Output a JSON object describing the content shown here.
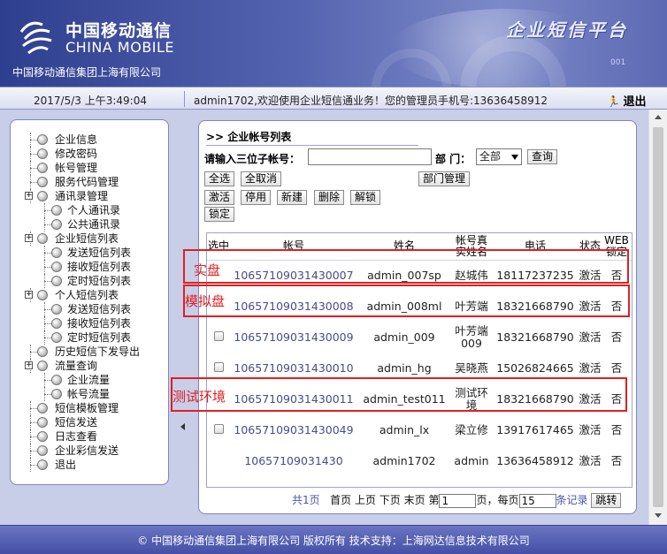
{
  "header": {
    "brand_cn": "中国移动通信",
    "brand_en": "CHINA MOBILE",
    "company": "中国移动通信集团上海有限公司",
    "platform_title": "企业短信平台",
    "deco_number": "001"
  },
  "infobar": {
    "datetime": "2017/5/3 上午3:49:04",
    "welcome": "admin1702,欢迎使用企业短信通业务！您的管理员手机号:13636458912",
    "logout": "退出"
  },
  "sidebar": {
    "items": [
      {
        "label": "企业信息",
        "level": 0,
        "expandable": false
      },
      {
        "label": "修改密码",
        "level": 0,
        "expandable": false
      },
      {
        "label": "帐号管理",
        "level": 0,
        "expandable": false
      },
      {
        "label": "服务代码管理",
        "level": 0,
        "expandable": false
      },
      {
        "label": "通讯录管理",
        "level": 0,
        "expandable": true
      },
      {
        "label": "个人通讯录",
        "level": 1,
        "expandable": false
      },
      {
        "label": "公共通讯录",
        "level": 1,
        "expandable": false
      },
      {
        "label": "企业短信列表",
        "level": 0,
        "expandable": true
      },
      {
        "label": "发送短信列表",
        "level": 1,
        "expandable": false
      },
      {
        "label": "接收短信列表",
        "level": 1,
        "expandable": false
      },
      {
        "label": "定时短信列表",
        "level": 1,
        "expandable": false
      },
      {
        "label": "个人短信列表",
        "level": 0,
        "expandable": true
      },
      {
        "label": "发送短信列表",
        "level": 1,
        "expandable": false
      },
      {
        "label": "接收短信列表",
        "level": 1,
        "expandable": false
      },
      {
        "label": "定时短信列表",
        "level": 1,
        "expandable": false
      },
      {
        "label": "历史短信下发导出",
        "level": 0,
        "expandable": false
      },
      {
        "label": "流量查询",
        "level": 0,
        "expandable": true
      },
      {
        "label": "企业流量",
        "level": 1,
        "expandable": false
      },
      {
        "label": "帐号流量",
        "level": 1,
        "expandable": false
      },
      {
        "label": "短信模板管理",
        "level": 0,
        "expandable": false
      },
      {
        "label": "短信发送",
        "level": 0,
        "expandable": false
      },
      {
        "label": "日志查看",
        "level": 0,
        "expandable": false
      },
      {
        "label": "企业彩信发送",
        "level": 0,
        "expandable": false
      },
      {
        "label": "退出",
        "level": 0,
        "expandable": false
      }
    ]
  },
  "main": {
    "title": ">> 企业帐号列表",
    "search_label": "请输入三位子帐号：",
    "search_value": "",
    "dept_label": "部 门：",
    "dept_selected": "全部",
    "query_button": "查询",
    "buttons": {
      "select_all": "全选",
      "deselect_all": "全取消",
      "dept_manage": "部门管理",
      "activate": "激活",
      "disable": "停用",
      "create": "新建",
      "delete": "删除",
      "unlock": "解锁",
      "lock": "锁定"
    },
    "table": {
      "headers": [
        "选中",
        "帐号",
        "姓名",
        "帐号真实姓名",
        "电话",
        "状态",
        "WEB锁定"
      ],
      "rows": [
        {
          "account": "10657109031430007",
          "name": "admin_007sp",
          "real_name": "赵城伟",
          "phone": "18117237235",
          "status": "激活",
          "web_lock": "否",
          "checkbox": false
        },
        {
          "account": "10657109031430008",
          "name": "admin_008ml",
          "real_name": "叶芳端",
          "phone": "18321668790",
          "status": "激活",
          "web_lock": "否",
          "checkbox": false
        },
        {
          "account": "10657109031430009",
          "name": "admin_009",
          "real_name": "叶芳端009",
          "phone": "18321668790",
          "status": "激活",
          "web_lock": "否",
          "checkbox": true
        },
        {
          "account": "10657109031430010",
          "name": "admin_hg",
          "real_name": "吴晓燕",
          "phone": "15026824665",
          "status": "激活",
          "web_lock": "否",
          "checkbox": true
        },
        {
          "account": "10657109031430011",
          "name": "admin_test011",
          "real_name": "测试环境",
          "phone": "18321668790",
          "status": "激活",
          "web_lock": "否",
          "checkbox": false
        },
        {
          "account": "10657109031430049",
          "name": "admin_lx",
          "real_name": "梁立修",
          "phone": "13917617465",
          "status": "激活",
          "web_lock": "否",
          "checkbox": true
        },
        {
          "account": "10657109031430",
          "name": "admin1702",
          "real_name": "admin",
          "phone": "13636458912",
          "status": "激活",
          "web_lock": "否",
          "checkbox": false
        }
      ]
    },
    "pager": {
      "total": "共1页",
      "first": "首页",
      "prev": "上页",
      "next": "下页",
      "last": "末页",
      "page_prefix": "第",
      "page_value": "1",
      "page_suffix": "页，每页",
      "per_page_value": "15",
      "per_page_suffix": "条记录",
      "go_button": "跳转"
    }
  },
  "annotations": {
    "live": "实盘",
    "simulated": "模拟盘",
    "test_env": "测试环境",
    "color": "#e02020"
  },
  "footer": {
    "text": "© 中国移动通信集团上海有限公司 版权所有    技术支持：上海网达信息技术有限公司"
  },
  "colors": {
    "header_dark": "#2e3f8f",
    "page_bg": "#c8cde8",
    "footer": "#4550a6",
    "account_link": "#454d8a"
  }
}
